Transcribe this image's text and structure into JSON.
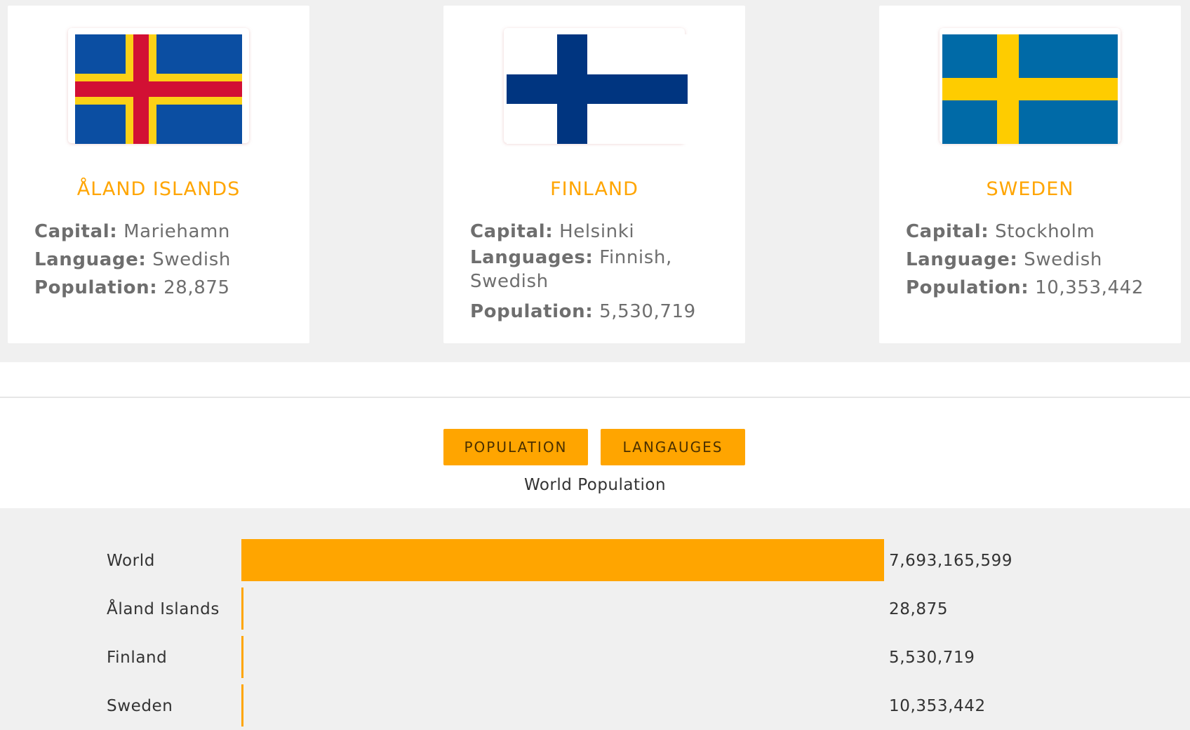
{
  "countries": [
    {
      "name": "ÅLAND ISLANDS",
      "flag": "aland-flag",
      "fields": [
        {
          "label": "Capital:",
          "value": "Mariehamn"
        },
        {
          "label": "Language:",
          "value": "Swedish"
        },
        {
          "label": "Population:",
          "value": "28,875"
        }
      ]
    },
    {
      "name": "FINLAND",
      "flag": "finland-flag",
      "fields": [
        {
          "label": "Capital:",
          "value": "Helsinki"
        },
        {
          "label": "Languages:",
          "value": "Finnish, Swedish"
        },
        {
          "label": "Population:",
          "value": "5,530,719"
        }
      ]
    },
    {
      "name": "SWEDEN",
      "flag": "sweden-flag",
      "fields": [
        {
          "label": "Capital:",
          "value": "Stockholm"
        },
        {
          "label": "Language:",
          "value": "Swedish"
        },
        {
          "label": "Population:",
          "value": "10,353,442"
        }
      ]
    }
  ],
  "buttons": {
    "population": "POPULATION",
    "languages": "LANGAUGES"
  },
  "chart_title": "World Population",
  "colors": {
    "accent": "#ffa500",
    "background": "#f0f0f0",
    "card": "#ffffff"
  },
  "chart_data": {
    "type": "bar",
    "orientation": "horizontal",
    "categories": [
      "World",
      "Åland Islands",
      "Finland",
      "Sweden"
    ],
    "values": [
      7693165599,
      28875,
      5530719,
      10353442
    ],
    "value_labels": [
      "7,693,165,599",
      "28,875",
      "5,530,719",
      "10,353,442"
    ],
    "title": "World Population",
    "xlim": [
      0,
      7693165599
    ],
    "grid": false
  }
}
